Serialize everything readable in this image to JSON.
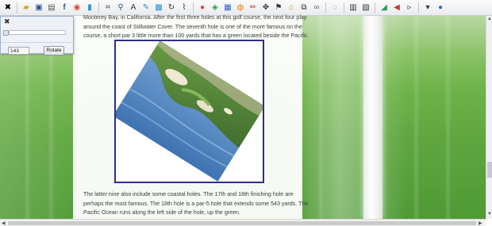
{
  "toolbar": {
    "icons": [
      "close-icon",
      "folder-icon",
      "save-icon",
      "print-icon",
      "facebook-icon",
      "browser-icon",
      "file-icon",
      "crop-icon",
      "zoom-icon",
      "text-icon",
      "draw-icon",
      "image-icon",
      "rotate-icon",
      "brush-icon",
      "color-icon",
      "select-icon",
      "eraser-icon",
      "fill-icon",
      "pencil-icon",
      "move-icon",
      "chain-icon",
      "settings-icon",
      "grid-icon",
      "layers-icon",
      "chart-icon",
      "speaker-icon",
      "arrow-icon",
      "help-icon"
    ]
  },
  "panel": {
    "angle_value": "143",
    "rotate_label": "Rotate"
  },
  "content": {
    "para1_line1": "Monterey Bay, in California. After the first three holes at this golf course, the next four play",
    "para1_line2": "around the coast of Stillwater Cover. The seventh hole is one of the more famous on the",
    "para1_line3": "course, a short par 3 little more than 100 yards that has a green located beside the Pacific.",
    "para2_line1": "The latter nine also include some coastal holes. The 17th and 18th finishing hole are",
    "para2_line2": "perhaps the most famous. The 18th hole is a par-5 hole that extends some 543 yards. The",
    "para2_line3": "Pacific Ocean runs along the left side of the hole, up the green."
  },
  "colors": {
    "frame_border": "#2d2f85",
    "grass": "#5fa63f"
  }
}
